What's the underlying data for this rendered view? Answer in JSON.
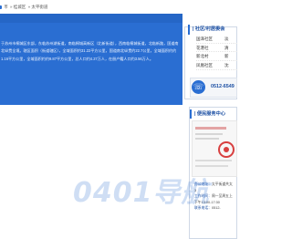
{
  "breadcrumb": {
    "items": [
      "币",
      "» 桂城区",
      "» 太平街道"
    ]
  },
  "intro": {
    "text": "于苏州市桐城区东部，东临苏州湖街道，南临桐城高新区（北新街道），西南临桐城街道，北临新路，国道南北纵贯全境。辖区面积（街道辖区），全域面积约31.22平方公里，国道南北纵贯约22.7公里，全域面积约约1.16平方公里，全域面积约约9.87平方公里，总人口约4.27万人，在册户籍人口约3.56万人。"
  },
  "sidebar": {
    "title": "| 社区/村居委会",
    "rows": [
      {
        "a": "国泽社区",
        "b": "淡"
      },
      {
        "a": "花港社",
        "b": "清"
      },
      {
        "a": "新北村",
        "b": "新"
      },
      {
        "a": "凤凰社区",
        "b": "沈"
      }
    ]
  },
  "phone": {
    "icon": "phone-icon",
    "number": "0512-6549"
  },
  "service": {
    "title": "| 便民服务中心",
    "info": [
      {
        "key": "办公地址：",
        "value": "太平街道共太"
      },
      {
        "key": "",
        "value": "3"
      },
      {
        "key": "工作时间：",
        "value": "周一至周五上"
      },
      {
        "key": "",
        "value": "下午13:00-17:30"
      },
      {
        "key": "联系电话：",
        "value": "0512-"
      }
    ]
  },
  "error": {
    "code_text": "0401导航"
  },
  "colors": {
    "accent": "#2a6ed2",
    "title": "#1b4fa3"
  }
}
